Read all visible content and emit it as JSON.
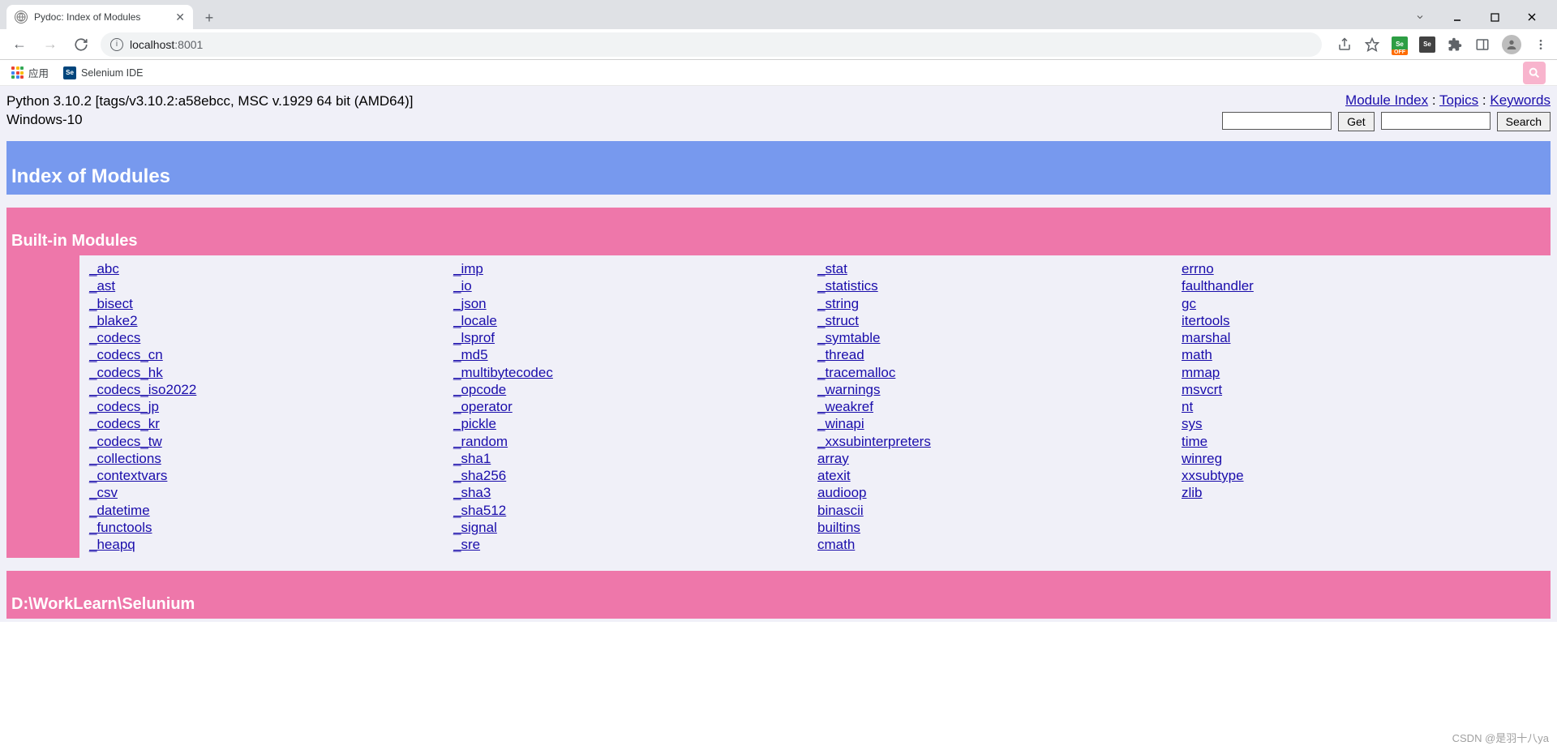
{
  "tab": {
    "title": "Pydoc: Index of Modules"
  },
  "address": {
    "host": "localhost",
    "port": ":8001"
  },
  "bookmarks": {
    "apps": "应用",
    "selenium_ide": "Selenium IDE"
  },
  "ext": {
    "off": "OFF",
    "se": "Se",
    "se2": "Se"
  },
  "top": {
    "version": "Python 3.10.2 [tags/v3.10.2:a58ebcc, MSC v.1929 64 bit (AMD64)]",
    "platform": "Windows-10",
    "links": {
      "module_index": "Module Index",
      "topics": "Topics",
      "keywords": "Keywords"
    },
    "buttons": {
      "get": "Get",
      "search": "Search"
    }
  },
  "heading": "Index of Modules",
  "builtin": {
    "title": "Built-in Modules",
    "c1": [
      "_abc",
      "_ast",
      "_bisect",
      "_blake2",
      "_codecs",
      "_codecs_cn",
      "_codecs_hk",
      "_codecs_iso2022",
      "_codecs_jp",
      "_codecs_kr",
      "_codecs_tw",
      "_collections",
      "_contextvars",
      "_csv",
      "_datetime",
      "_functools",
      "_heapq"
    ],
    "c2": [
      "_imp",
      "_io",
      "_json",
      "_locale",
      "_lsprof",
      "_md5",
      "_multibytecodec",
      "_opcode",
      "_operator",
      "_pickle",
      "_random",
      "_sha1",
      "_sha256",
      "_sha3",
      "_sha512",
      "_signal",
      "_sre"
    ],
    "c3": [
      "_stat",
      "_statistics",
      "_string",
      "_struct",
      "_symtable",
      "_thread",
      "_tracemalloc",
      "_warnings",
      "_weakref",
      "_winapi",
      "_xxsubinterpreters",
      "array",
      "atexit",
      "audioop",
      "binascii",
      "builtins",
      "cmath"
    ],
    "c4": [
      "errno",
      "faulthandler",
      "gc",
      "itertools",
      "marshal",
      "math",
      "mmap",
      "msvcrt",
      "nt",
      "sys",
      "time",
      "winreg",
      "xxsubtype",
      "zlib"
    ]
  },
  "path_section": {
    "title": "D:\\WorkLearn\\Selunium"
  },
  "watermark": "CSDN @是羽十八ya"
}
